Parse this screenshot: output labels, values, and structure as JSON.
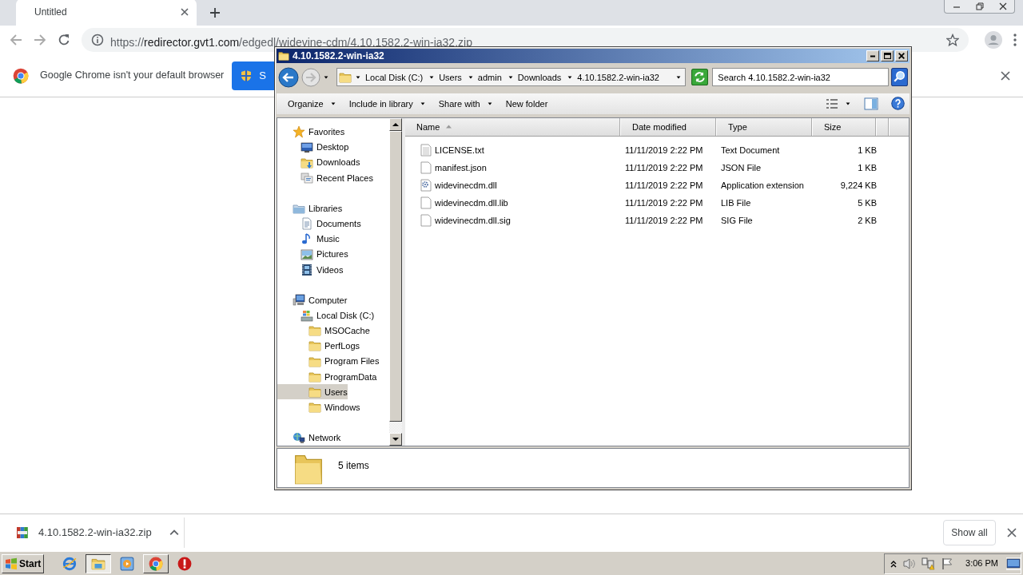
{
  "browser": {
    "tab": {
      "title": "Untitled"
    },
    "address": "https://redirector.gvt1.com/edgedl/widevine-cdm/4.10.1582.2-win-ia32.zip",
    "infobar": {
      "message": "Google Chrome isn't your default browser",
      "button": "S"
    }
  },
  "explorer": {
    "title": "4.10.1582.2-win-ia32",
    "breadcrumb": [
      "Local Disk (C:)",
      "Users",
      "admin",
      "Downloads",
      "4.10.1582.2-win-ia32"
    ],
    "search": {
      "placeholder": "Search 4.10.1582.2-win-ia32"
    },
    "toolbar": [
      {
        "label": "Organize",
        "menu": true
      },
      {
        "label": "Include in library",
        "menu": true
      },
      {
        "label": "Share with",
        "menu": true
      },
      {
        "label": "New folder",
        "menu": false
      }
    ],
    "navigation": [
      {
        "label": "Favorites",
        "kind": "star",
        "selected": false,
        "children": [
          {
            "label": "Desktop",
            "kind": "desktop",
            "selected": false
          },
          {
            "label": "Downloads",
            "kind": "downloads",
            "selected": false
          },
          {
            "label": "Recent Places",
            "kind": "recent",
            "selected": false
          }
        ]
      },
      {
        "label": "Libraries",
        "kind": "library",
        "selected": false,
        "children": [
          {
            "label": "Documents",
            "kind": "documents",
            "selected": false
          },
          {
            "label": "Music",
            "kind": "music",
            "selected": false
          },
          {
            "label": "Pictures",
            "kind": "pictures",
            "selected": false
          },
          {
            "label": "Videos",
            "kind": "videos",
            "selected": false
          }
        ]
      },
      {
        "label": "Computer",
        "kind": "computer",
        "selected": false,
        "children": [
          {
            "label": "Local Disk (C:)",
            "kind": "disk",
            "selected": false,
            "children": [
              {
                "label": "MSOCache",
                "kind": "folder",
                "selected": false
              },
              {
                "label": "PerfLogs",
                "kind": "folder",
                "selected": false
              },
              {
                "label": "Program Files",
                "kind": "folder",
                "selected": false
              },
              {
                "label": "ProgramData",
                "kind": "folder",
                "selected": false
              },
              {
                "label": "Users",
                "kind": "folder",
                "selected": true
              },
              {
                "label": "Windows",
                "kind": "folder",
                "selected": false
              }
            ]
          }
        ]
      },
      {
        "label": "Network",
        "kind": "network",
        "selected": false
      }
    ],
    "columns": [
      {
        "label": "Name",
        "sorted": true
      },
      {
        "label": "Date modified",
        "sorted": false
      },
      {
        "label": "Type",
        "sorted": false
      },
      {
        "label": "Size",
        "sorted": false
      }
    ],
    "files": [
      {
        "name": "LICENSE.txt",
        "kind": "text",
        "date": "11/11/2019 2:22 PM",
        "type": "Text Document",
        "size": "1 KB"
      },
      {
        "name": "manifest.json",
        "kind": "blank",
        "date": "11/11/2019 2:22 PM",
        "type": "JSON File",
        "size": "1 KB"
      },
      {
        "name": "widevinecdm.dll",
        "kind": "dll",
        "date": "11/11/2019 2:22 PM",
        "type": "Application extension",
        "size": "9,224 KB"
      },
      {
        "name": "widevinecdm.dll.lib",
        "kind": "blank",
        "date": "11/11/2019 2:22 PM",
        "type": "LIB File",
        "size": "5 KB"
      },
      {
        "name": "widevinecdm.dll.sig",
        "kind": "blank",
        "date": "11/11/2019 2:22 PM",
        "type": "SIG File",
        "size": "2 KB"
      }
    ],
    "details": "5 items"
  },
  "downloads": {
    "items": [
      {
        "name": "4.10.1582.2-win-ia32.zip"
      }
    ],
    "show_all": "Show all"
  },
  "taskbar": {
    "start": "Start",
    "apps": [
      {
        "kind": "globe",
        "open": false,
        "active": false
      },
      {
        "kind": "folder",
        "open": true,
        "active": true
      },
      {
        "kind": "play",
        "open": false,
        "active": false
      },
      {
        "kind": "roundlogo",
        "open": true,
        "active": false
      },
      {
        "kind": "stop",
        "open": false,
        "active": false
      }
    ],
    "clock": "3:06 PM"
  }
}
